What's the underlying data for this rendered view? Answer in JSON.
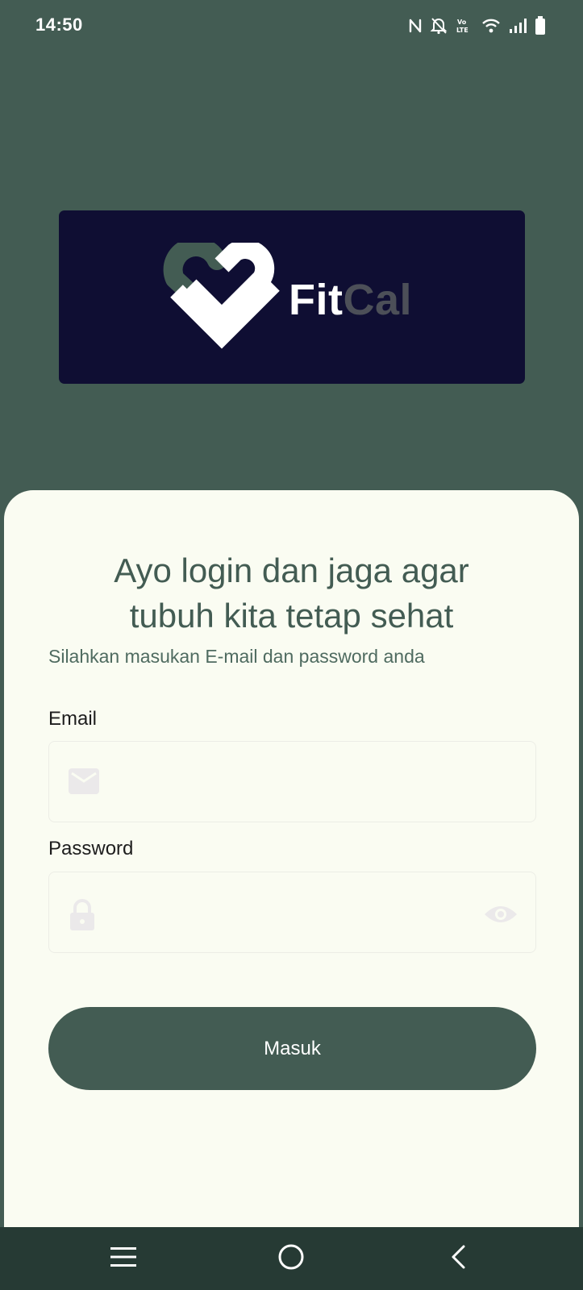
{
  "status_bar": {
    "time": "14:50",
    "icons": [
      "nfc-icon",
      "bell-off-icon",
      "volte-icon",
      "wifi-icon",
      "signal-icon",
      "battery-icon"
    ]
  },
  "logo": {
    "word_part_a": "Fit",
    "word_part_b": "Cal",
    "colors": {
      "background": "#0f0e33",
      "mark_green": "#435c53",
      "mark_white": "#ffffff",
      "word_gray": "#4c4f58"
    }
  },
  "login": {
    "headline_line1": "Ayo login dan jaga agar",
    "headline_line2": "tubuh kita tetap sehat",
    "subtitle": "Silahkan masukan E-mail dan password anda",
    "email_label": "Email",
    "email_value": "",
    "email_icon": "mail-icon",
    "password_label": "Password",
    "password_value": "",
    "password_icon": "lock-icon",
    "password_toggle_icon": "eye-icon",
    "submit_label": "Masuk"
  },
  "nav_bar": {
    "items": [
      "menu-icon",
      "home-icon",
      "back-icon"
    ]
  },
  "theme": {
    "primary": "#435c53",
    "card_background": "#fafcf2",
    "nav_background": "#263a34"
  }
}
